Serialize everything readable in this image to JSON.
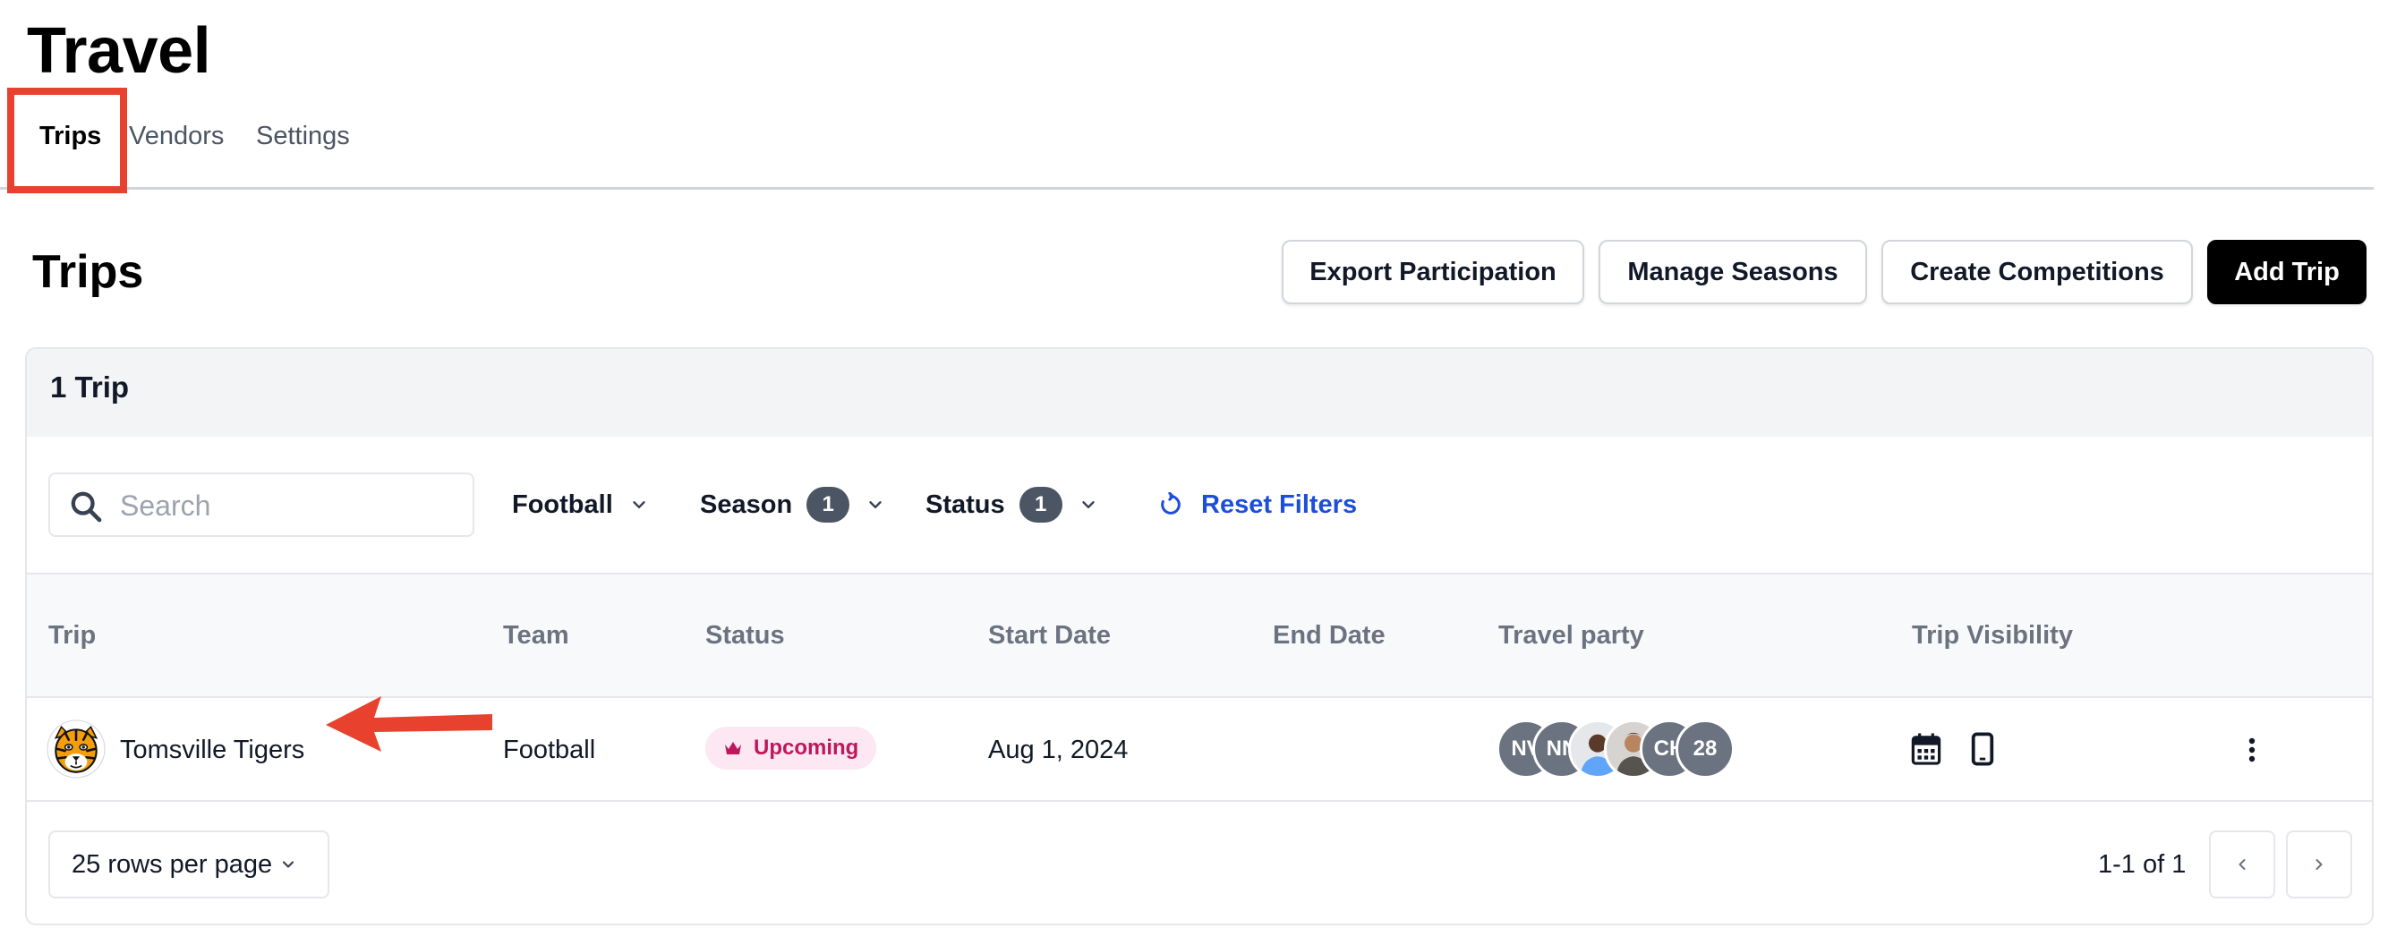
{
  "app": {
    "title": "Travel"
  },
  "tabs": [
    {
      "label": "Trips",
      "active": true
    },
    {
      "label": "Vendors",
      "active": false
    },
    {
      "label": "Settings",
      "active": false
    }
  ],
  "section": {
    "title": "Trips"
  },
  "actions": {
    "export": "Export Participation",
    "seasons": "Manage Seasons",
    "competitions": "Create Competitions",
    "add": "Add Trip"
  },
  "card": {
    "count_label": "1 Trip"
  },
  "search": {
    "placeholder": "Search",
    "value": ""
  },
  "filters": {
    "sport": {
      "label": "Football"
    },
    "season": {
      "label": "Season",
      "count": "1"
    },
    "status": {
      "label": "Status",
      "count": "1"
    },
    "reset": "Reset Filters"
  },
  "table": {
    "columns": [
      "Trip",
      "Team",
      "Status",
      "Start Date",
      "End Date",
      "Travel party",
      "Trip Visibility"
    ],
    "rows": [
      {
        "trip": "Tomsville Tigers",
        "team": "Football",
        "status": "Upcoming",
        "start_date": "Aug 1, 2024",
        "end_date": "",
        "travel_party": {
          "avatars": [
            {
              "type": "initials",
              "text": "NV"
            },
            {
              "type": "initials",
              "text": "NN"
            },
            {
              "type": "photo",
              "text": ""
            },
            {
              "type": "photo",
              "text": ""
            },
            {
              "type": "initials",
              "text": "CH"
            },
            {
              "type": "count",
              "text": "28"
            }
          ]
        },
        "visibility_icons": [
          "calendar-icon",
          "mobile-phone-icon"
        ]
      }
    ]
  },
  "pagination": {
    "rows_per_page": "25 rows per page",
    "range": "1-1 of 1"
  },
  "colors": {
    "accent_blue": "#1d4ed8",
    "status_pink_bg": "#fce7f3",
    "status_pink_text": "#be185d",
    "annotation_red": "#e8412e",
    "primary_button": "#000000"
  }
}
